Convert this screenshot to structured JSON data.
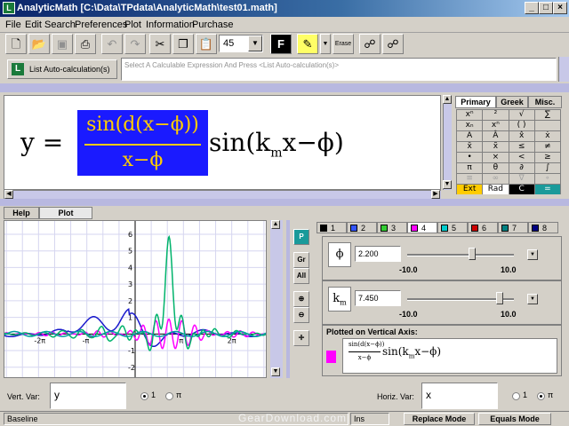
{
  "window": {
    "title": "AnalyticMath  [C:\\Data\\TPdata\\AnalyticMath\\test01.math]",
    "minimize": "_",
    "maximize": "□",
    "close": "×"
  },
  "menu": [
    "File",
    "Edit",
    "Search",
    "Preferences",
    "Plot",
    "Information",
    "Purchase"
  ],
  "toolbar": {
    "font_size": "45",
    "format_label": "F",
    "erase_label": "Erase"
  },
  "calc": {
    "button_label": "List Auto-calculation(s)",
    "placeholder": "Select A Calculable Expression And Press <List Auto-calculation(s)>"
  },
  "formula": {
    "lhs": "y =",
    "numerator": "sin(d(x−ϕ))",
    "denominator": "x−ϕ",
    "rhs_pre": "sin(k",
    "rhs_sub": "m",
    "rhs_post": "x−ϕ)"
  },
  "palette": {
    "tabs": [
      "Primary",
      "Greek",
      "Misc."
    ],
    "cells": [
      "xⁿ",
      "²",
      "√",
      "∑",
      "xₙ",
      "xⁿ",
      "( )",
      "",
      "A",
      "Â",
      "x̂",
      "ẋ",
      "x̄",
      "x̃",
      "≤",
      "≠",
      "•",
      "×",
      "<",
      "≥",
      "π",
      "θ",
      "∂",
      "∫",
      "≡",
      "∞",
      "∇",
      "∘",
      "Ext",
      "Rad",
      "C",
      "="
    ]
  },
  "bottom_tabs": [
    "Help",
    "Plot"
  ],
  "plot": {
    "x_tick_labels": [
      "-2π",
      "-π",
      "π",
      "2π"
    ],
    "y_tick_labels": [
      "6",
      "5",
      "4",
      "3",
      "2",
      "1",
      "-1",
      "-2"
    ],
    "series_colors": [
      "#1a1acc",
      "#ff00ff",
      "#00b36b",
      "#00a0a0"
    ]
  },
  "controls": {
    "p_label": "P",
    "gr_label": "Gr",
    "all_label": "All"
  },
  "function_tabs": [
    {
      "n": "1",
      "color": "#000000"
    },
    {
      "n": "2",
      "color": "#3355ff"
    },
    {
      "n": "3",
      "color": "#33cc33"
    },
    {
      "n": "4",
      "color": "#ff00ff"
    },
    {
      "n": "5",
      "color": "#00cccc"
    },
    {
      "n": "6",
      "color": "#cc0000"
    },
    {
      "n": "7",
      "color": "#008080"
    },
    {
      "n": "8",
      "color": "#000080"
    }
  ],
  "params": [
    {
      "symbol": "ϕ",
      "value": "2.200",
      "min": "-10.0",
      "max": "10.0",
      "level": 0.61
    },
    {
      "symbol": "k",
      "symbol_sub": "m",
      "value": "7.450",
      "min": "-10.0",
      "max": "10.0",
      "level": 0.87
    }
  ],
  "plotted": {
    "label": "Plotted on Vertical Axis:",
    "expr_num": "sin(d(x−ϕ))",
    "expr_den": "x−ϕ",
    "expr_rest": "sin(k",
    "expr_sub": "m",
    "expr_post": "x−ϕ)"
  },
  "vars": {
    "vert_label": "Vert. Var:",
    "vert_value": "y",
    "horiz_label": "Horiz. Var:",
    "horiz_value": "x",
    "opt1": "1",
    "opt2": "π"
  },
  "status": {
    "mode": "Baseline",
    "ins": "Ins",
    "replace": "Replace Mode",
    "equals": "Equals Mode",
    "watermark": "GearDownload.com"
  }
}
